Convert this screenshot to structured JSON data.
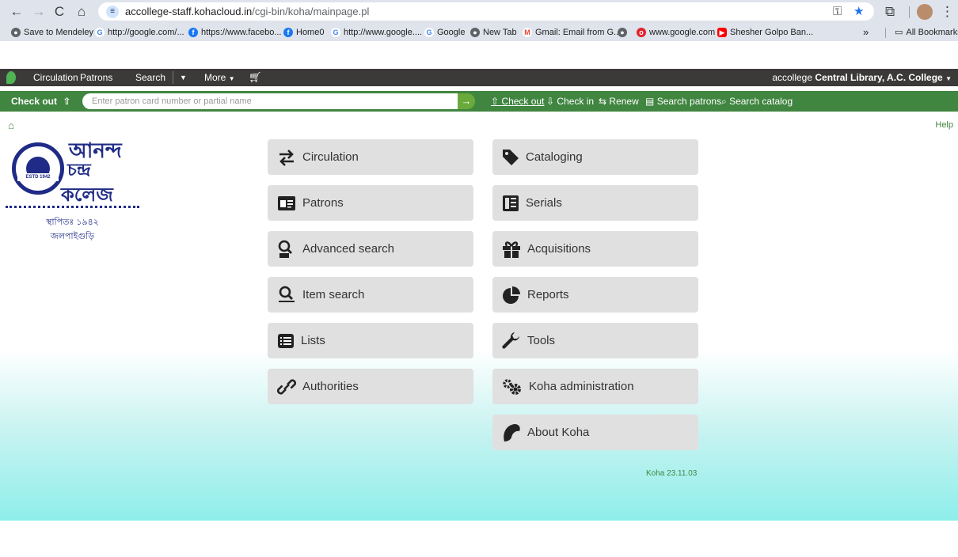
{
  "browser": {
    "url_host": "accollege-staff.kohacloud.in",
    "url_path": "/cgi-bin/koha/mainpage.pl",
    "bookmarks": [
      {
        "label": "Save to Mendeley",
        "icon": "globe-icon"
      },
      {
        "label": "http://google.com/...",
        "icon": "google-icon"
      },
      {
        "label": "https://www.facebo...",
        "icon": "facebook-icon"
      },
      {
        "label": "Home0",
        "icon": "facebook-icon"
      },
      {
        "label": "http://www.google....",
        "icon": "google-icon"
      },
      {
        "label": "Google",
        "icon": "google-icon"
      },
      {
        "label": "New Tab",
        "icon": "globe-icon"
      },
      {
        "label": "Gmail: Email from G...",
        "icon": "gmail-icon"
      },
      {
        "label": "",
        "icon": "globe-icon"
      },
      {
        "label": "www.google.com",
        "icon": "opera-icon"
      },
      {
        "label": "Shesher Golpo Ban...",
        "icon": "youtube-icon"
      }
    ],
    "overflow": "»",
    "all_bookmarks": "All Bookmarks"
  },
  "koha_nav": {
    "items": [
      "Circulation",
      "Patrons",
      "Search",
      "More"
    ],
    "user_prefix": "accollege",
    "library": "Central Library, A.C. College"
  },
  "checkout_bar": {
    "label": "Check out",
    "placeholder": "Enter patron card number or partial name",
    "links": [
      "Check out",
      "Check in",
      "Renew",
      "Search patrons",
      "Search catalog"
    ]
  },
  "main": {
    "help": "Help",
    "logo": {
      "line1": "আনন্দ",
      "line2": "চন্দ্র",
      "line3": "কলেজ",
      "founded": "স্থাপিতঃ ১৯৪২",
      "place": "জলপাইগুড়ি",
      "seal_text": "ESTD 1942"
    },
    "left_tiles": [
      "Circulation",
      "Patrons",
      "Advanced search",
      "Item search",
      "Lists",
      "Authorities"
    ],
    "right_tiles": [
      "Cataloging",
      "Serials",
      "Acquisitions",
      "Reports",
      "Tools",
      "Koha administration",
      "About Koha"
    ],
    "version": "Koha 23.11.03"
  }
}
